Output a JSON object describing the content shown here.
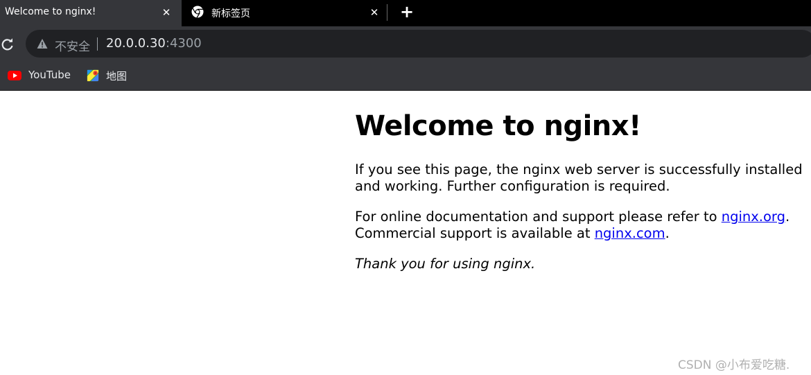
{
  "tabs": [
    {
      "title": "Welcome to nginx!",
      "active": true,
      "close": "✕"
    },
    {
      "title": "新标签页",
      "active": false,
      "close": "✕"
    }
  ],
  "new_tab_label": "+",
  "address_bar": {
    "security_label": "不安全",
    "url_host": "20.0.0.30",
    "url_port": ":4300"
  },
  "bookmarks": [
    {
      "label": "YouTube",
      "icon": "youtube-icon"
    },
    {
      "label": "地图",
      "icon": "maps-icon"
    }
  ],
  "page": {
    "heading": "Welcome to nginx!",
    "para1": "If you see this page, the nginx web server is successfully installed and working. Further configuration is required.",
    "para2_prefix": "For online documentation and support please refer to ",
    "link_org": "nginx.org",
    "para2_mid": ". Commercial support is available at ",
    "link_com": "nginx.com",
    "para2_suffix": ".",
    "para3": "Thank you for using nginx."
  },
  "watermark": "CSDN @小布爱吃糖."
}
